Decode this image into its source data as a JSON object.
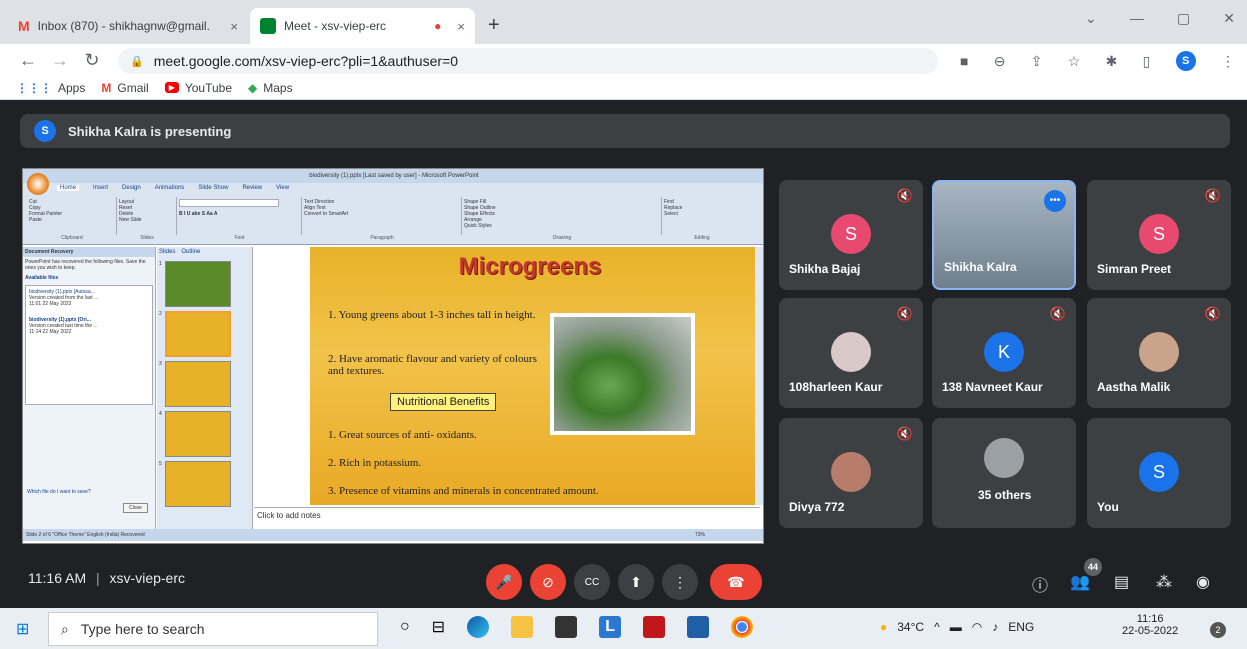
{
  "tabs": [
    {
      "label": "Inbox (870) - shikhagnw@gmail.",
      "close": "×",
      "icon": "gmail-icon"
    },
    {
      "label": "Meet - xsv-viep-erc",
      "close": "×",
      "icon": "meet-icon"
    }
  ],
  "new_tab": "+",
  "window_controls": [
    "⌄",
    "—",
    "▢",
    "✕"
  ],
  "url": "meet.google.com/xsv-viep-erc?pli=1&authuser=0",
  "profile_initial": "S",
  "bookmarks": [
    "Apps",
    "Gmail",
    "YouTube",
    "Maps"
  ],
  "presenter": {
    "initial": "S",
    "text": "Shikha Kalra is presenting"
  },
  "ppt": {
    "title": "biodiversity (1).pptx [Last saved by user] - Microsoft PowerPoint",
    "ribbon_tabs": [
      "Home",
      "Insert",
      "Design",
      "Animations",
      "Slide Show",
      "Review",
      "View"
    ],
    "ribbon_groups": [
      "Clipboard",
      "Slides",
      "Font",
      "Paragraph",
      "Drawing",
      "Editing"
    ],
    "clipboard": [
      "Cut",
      "Copy",
      "Format Painter",
      "Paste"
    ],
    "slides_group": [
      "Layout",
      "Reset",
      "Delete",
      "New Slide"
    ],
    "editing": [
      "Find",
      "Replace",
      "Select"
    ],
    "drawing": [
      "Shape Fill",
      "Shape Outline",
      "Shape Effects",
      "Arrange",
      "Quick Styles"
    ],
    "paragraph": [
      "Text Direction",
      "Align Text",
      "Convert to SmartArt"
    ],
    "recovery_title": "Document Recovery",
    "recovery_msg": "PowerPoint has recovered the following files. Save the ones you wish to keep.",
    "available": "Available files",
    "files": [
      {
        "name": "biodiversity (1).pptx [Autosa...",
        "line2": "Version created from the last ...",
        "line3": "11:01 22 May 2022"
      },
      {
        "name": "biodiversity (1).pptx [Ori...",
        "line2": "Version created last time the ...",
        "line3": "11:14 22 May 2022"
      }
    ],
    "which_file": "Which file do I want to save?",
    "close_btn": "Close",
    "pane_tabs": [
      "Slides",
      "Outline"
    ],
    "slide_numbers": [
      "1",
      "2",
      "3",
      "4",
      "5"
    ],
    "notes": "Click to add notes",
    "status": "Slide 2 of 6   \"Office Theme\"   English (India)   Recovered",
    "zoom": "73%"
  },
  "slide": {
    "title": "Microgreens",
    "points": [
      "1.  Young greens about 1-3 inches tall in height.",
      "2.  Have aromatic flavour and variety of colours and textures."
    ],
    "subheading": "Nutritional Benefits",
    "benefits": [
      "1.  Great sources of anti- oxidants.",
      "2.  Rich in potassium.",
      "3.  Presence of vitamins and minerals in concentrated amount."
    ]
  },
  "participants": [
    {
      "name": "Shikha Bajaj",
      "initial": "S",
      "color": "#e84a6f"
    },
    {
      "name": "Shikha Kalra",
      "initial": "",
      "color": "#8a9aa8"
    },
    {
      "name": "Simran Preet",
      "initial": "S",
      "color": "#e84a6f"
    },
    {
      "name": "108harleen Kaur",
      "initial": "",
      "color": "#d9c9c9"
    },
    {
      "name": "138 Navneet Kaur",
      "initial": "K",
      "color": "#1a73e8"
    },
    {
      "name": "Aastha Malik",
      "initial": "",
      "color": "#c9a38a"
    },
    {
      "name": "Divya 772",
      "initial": "",
      "color": "#b87c6a"
    },
    {
      "name": "35 others",
      "initial": "",
      "color": "#9aa0a6"
    },
    {
      "name": "You",
      "initial": "S",
      "color": "#1a73e8"
    }
  ],
  "meeting": {
    "time": "11:16 AM",
    "separator": "|",
    "code": "xsv-viep-erc",
    "people_count": "44"
  },
  "taskbar": {
    "search": "Type here to search",
    "weather": "34°C",
    "lang": "ENG",
    "time": "11:16",
    "date": "22-05-2022",
    "notif": "2"
  },
  "colors": {
    "meet_bg": "#202124",
    "tile": "#3c4043",
    "red": "#ea4335",
    "blue": "#1a73e8"
  }
}
